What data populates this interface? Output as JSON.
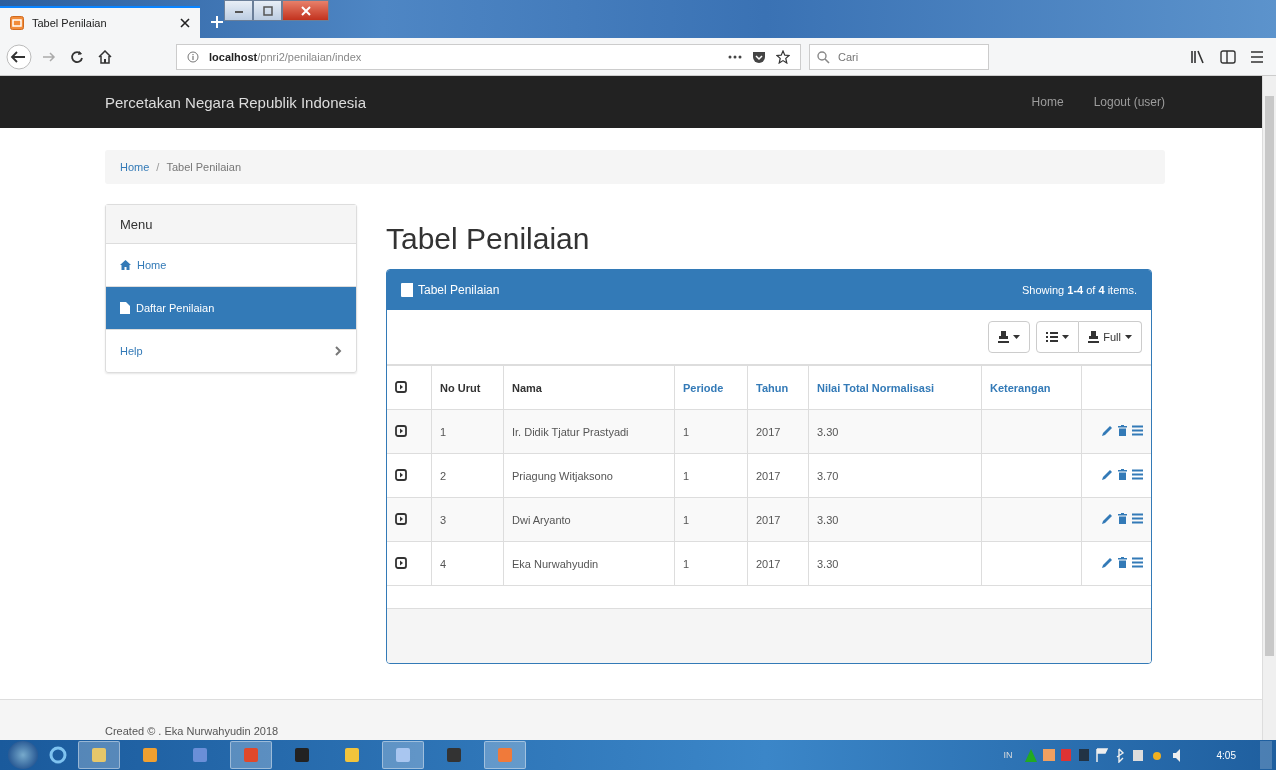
{
  "browser": {
    "tab_title": "Tabel Penilaian",
    "url_host": "localhost",
    "url_path": "/pnri2/penilaian/index",
    "search": {
      "placeholder": "Cari"
    }
  },
  "navbar": {
    "brand": "Percetakan Negara Republik Indonesia",
    "links": [
      "Home",
      "Logout (user)"
    ]
  },
  "breadcrumb_separator": "/",
  "breadcrumb": [
    {
      "label": "Home",
      "kind": "link"
    },
    {
      "label": "Tabel Penilaian",
      "kind": "current"
    }
  ],
  "sidebar": {
    "heading": "Menu",
    "items": [
      {
        "label": "Home",
        "kind": "home",
        "selected": false
      },
      {
        "label": "Daftar Penilaian",
        "kind": "page",
        "selected": true
      },
      {
        "label": "Help",
        "kind": "submenu",
        "selected": false
      }
    ]
  },
  "page_title": "Tabel Penilaian",
  "panel": {
    "title": "Tabel Penilaian",
    "summary": "Showing **1-4** of **4** items.",
    "toolbar": [
      {
        "kind": "export"
      },
      {
        "kind": "columns"
      },
      {
        "kind": "toggle",
        "label": "Full"
      }
    ],
    "columns": [
      {
        "kind": "expand"
      },
      {
        "label": "No Urut",
        "sortable": false
      },
      {
        "label": "Nama",
        "sortable": false
      },
      {
        "label": "Periode",
        "sortable": true
      },
      {
        "label": "Tahun",
        "sortable": true
      },
      {
        "label": "Nilai Total Normalisasi",
        "sortable": true
      },
      {
        "label": "Keterangan",
        "sortable": true
      },
      {
        "kind": "actions"
      }
    ],
    "rows": [
      {
        "no": "1",
        "nama": "Ir. Didik Tjatur Prastyadi",
        "periode": "1",
        "tahun": "2017",
        "nilai": "3.30"
      },
      {
        "no": "2",
        "nama": "Priagung Witjaksono",
        "periode": "1",
        "tahun": "2017",
        "nilai": "3.70"
      },
      {
        "no": "3",
        "nama": "Dwi Aryanto",
        "periode": "1",
        "tahun": "2017",
        "nilai": "3.30"
      },
      {
        "no": "4",
        "nama": "Eka Nurwahyudin",
        "periode": "1",
        "tahun": "2017",
        "nilai": "3.30"
      }
    ]
  },
  "footer": "Created © . Eka Nurwahyudin 2018",
  "taskbar": {
    "language": "IN",
    "clock": "4:05"
  }
}
